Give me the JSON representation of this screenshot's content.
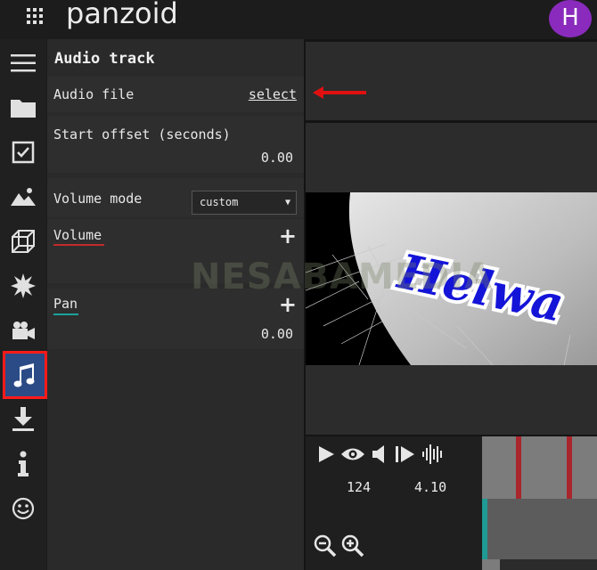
{
  "app": {
    "logo_text": "panzoid",
    "avatar_initial": "H"
  },
  "sidebar": {
    "items": [
      {
        "name": "menu",
        "icon": "hamburger-icon"
      },
      {
        "name": "project",
        "icon": "folder-icon"
      },
      {
        "name": "tasks",
        "icon": "checkbox-icon"
      },
      {
        "name": "backgrounds",
        "icon": "image-icon"
      },
      {
        "name": "3d-objects",
        "icon": "cube-icon"
      },
      {
        "name": "effects",
        "icon": "burst-icon"
      },
      {
        "name": "camera",
        "icon": "camera-icon"
      },
      {
        "name": "audio",
        "icon": "music-icon",
        "selected": true
      },
      {
        "name": "export",
        "icon": "download-icon"
      },
      {
        "name": "info",
        "icon": "info-icon"
      },
      {
        "name": "feedback",
        "icon": "smiley-icon"
      }
    ]
  },
  "panel": {
    "title": "Audio track",
    "audio_file": {
      "label": "Audio file",
      "action": "select"
    },
    "start_offset": {
      "label": "Start offset (seconds)",
      "value": "0.00"
    },
    "volume_mode": {
      "label": "Volume mode",
      "selected": "custom"
    },
    "volume": {
      "label": "Volume"
    },
    "pan": {
      "label": "Pan",
      "value": "0.00"
    }
  },
  "preview": {
    "text": "Helwa",
    "watermark": "NESABAMEDIA"
  },
  "timeline": {
    "frame": "124",
    "time": "4.10"
  },
  "colors": {
    "accent_selected": "#2b4b86",
    "highlight_border": "#ff1a1a",
    "avatar": "#8a2bbd",
    "volume_underline": "#c22a2a",
    "pan_underline": "#1aa39a",
    "annotation_arrow": "#e01010"
  }
}
